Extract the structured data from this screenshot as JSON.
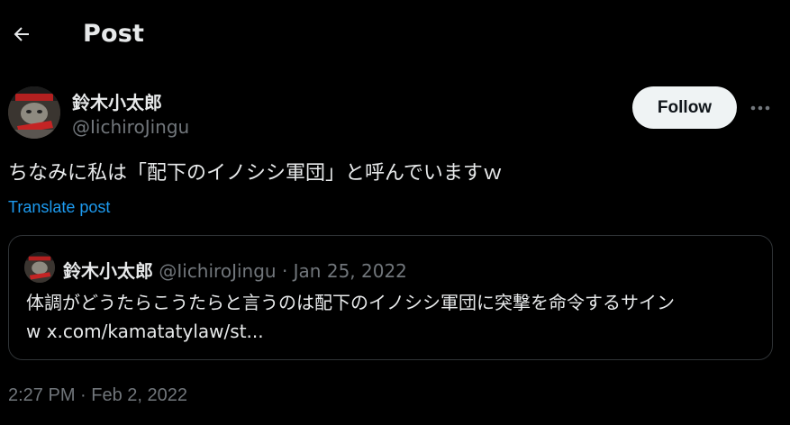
{
  "header": {
    "title": "Post",
    "back_icon": "arrow-left-icon"
  },
  "author": {
    "display_name": "鈴木小太郎",
    "handle": "@IichiroJingu",
    "follow_label": "Follow",
    "more_icon": "more-horizontal-icon"
  },
  "tweet": {
    "text": "ちなみに私は「配下のイノシシ軍団」と呼んでいますｗ",
    "translate_label": "Translate post",
    "timestamp": "2:27 PM · Feb 2, 2022"
  },
  "quote": {
    "display_name": "鈴木小太郎",
    "handle": "@IichiroJingu",
    "separator": "·",
    "date": "Jan 25, 2022",
    "text_line1": "体調がどうたらこうたらと言うのは配下のイノシシ軍団に突撃を命令するサイン",
    "text_line2": "w x.com/kamatatylaw/st..."
  },
  "colors": {
    "background": "#000000",
    "primary_text": "#e7e9ea",
    "secondary_text": "#71767b",
    "link": "#1d9bf0",
    "border": "#2f3336",
    "follow_bg": "#eff3f4"
  }
}
